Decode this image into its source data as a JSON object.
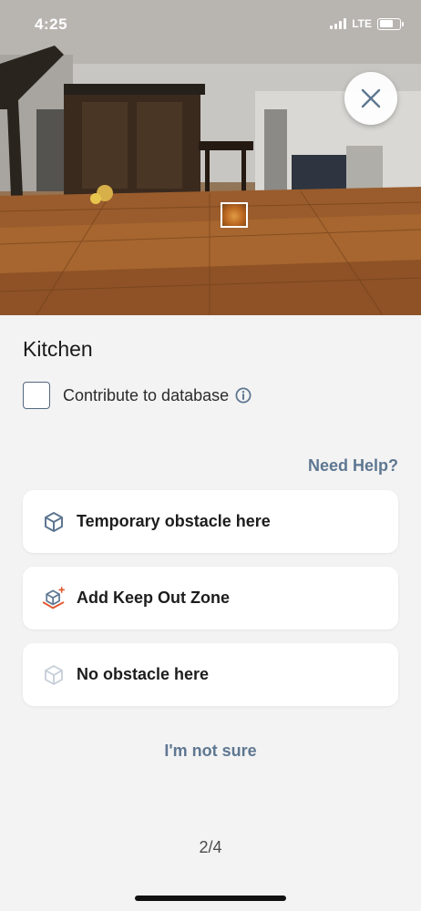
{
  "status_bar": {
    "time": "4:25",
    "network": "LTE",
    "battery_level": 0.7
  },
  "camera": {
    "close_icon": "close-icon",
    "detected_object": "obstacle-marker"
  },
  "room": {
    "title": "Kitchen"
  },
  "contribute": {
    "label": "Contribute to database",
    "checked": false,
    "info_icon": "info-icon"
  },
  "help": {
    "label": "Need Help?"
  },
  "options": [
    {
      "label": "Temporary obstacle here",
      "icon": "cube-icon"
    },
    {
      "label": "Add Keep Out Zone",
      "icon": "keep-out-zone-icon"
    },
    {
      "label": "No obstacle here",
      "icon": "cube-outline-icon"
    }
  ],
  "not_sure": {
    "label": "I'm not sure"
  },
  "pagination": {
    "label": "2/4"
  },
  "colors": {
    "accent": "#5e7791",
    "keep_out": "#e2542c",
    "background": "#f3f3f3"
  }
}
